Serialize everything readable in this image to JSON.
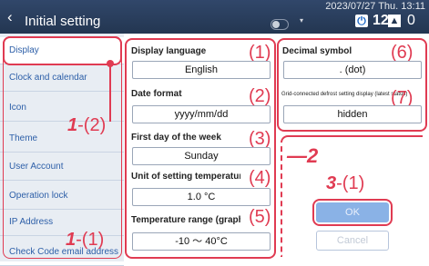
{
  "header": {
    "back_icon": "‹",
    "title": "Initial setting",
    "datetime": "2023/07/27 Thu. 13:11",
    "power_icon": "⏻",
    "power_count": "128",
    "warn_icon": "▲",
    "warn_count": "0",
    "chevron": "▾"
  },
  "sidebar": {
    "items": [
      {
        "label": "Display"
      },
      {
        "label": "Clock and calendar"
      },
      {
        "label": "Icon"
      },
      {
        "label": "Theme"
      },
      {
        "label": "User Account"
      },
      {
        "label": "Operation lock"
      },
      {
        "label": "IP Address"
      },
      {
        "label": "Check Code email address"
      }
    ]
  },
  "fields": {
    "display_language": {
      "label": "Display language",
      "value": "English",
      "num": "(1)"
    },
    "decimal_symbol": {
      "label": "Decimal symbol",
      "value": ". (dot)",
      "num": "(6)"
    },
    "date_format": {
      "label": "Date format",
      "value": "yyyy/mm/dd",
      "num": "(2)"
    },
    "defrost": {
      "label": "Grid-connected defrost setting display (latest status)",
      "value": "hidden",
      "num": "(7)"
    },
    "first_day": {
      "label": "First day of the week",
      "value": "Sunday",
      "num": "(3)"
    },
    "unit": {
      "label": "Unit of setting temperature",
      "value": "1.0 °C",
      "num": "(4)"
    },
    "range": {
      "label": "Temperature range (graph)",
      "value": "-10 ～ 40°C",
      "num": "(5)"
    }
  },
  "annotations": {
    "a1_2": {
      "num": "1",
      "part": "-(2)"
    },
    "a1_1": {
      "num": "1",
      "part": "-(1)"
    },
    "a2": "—2",
    "a3": {
      "num": "3",
      "part": "-(1)"
    }
  },
  "buttons": {
    "ok": "OK",
    "cancel": "Cancel"
  },
  "colors": {
    "header": "#233651",
    "annotation": "#e03b52",
    "sidebar": "#e8edf3",
    "ok": "#8ab2e6"
  }
}
